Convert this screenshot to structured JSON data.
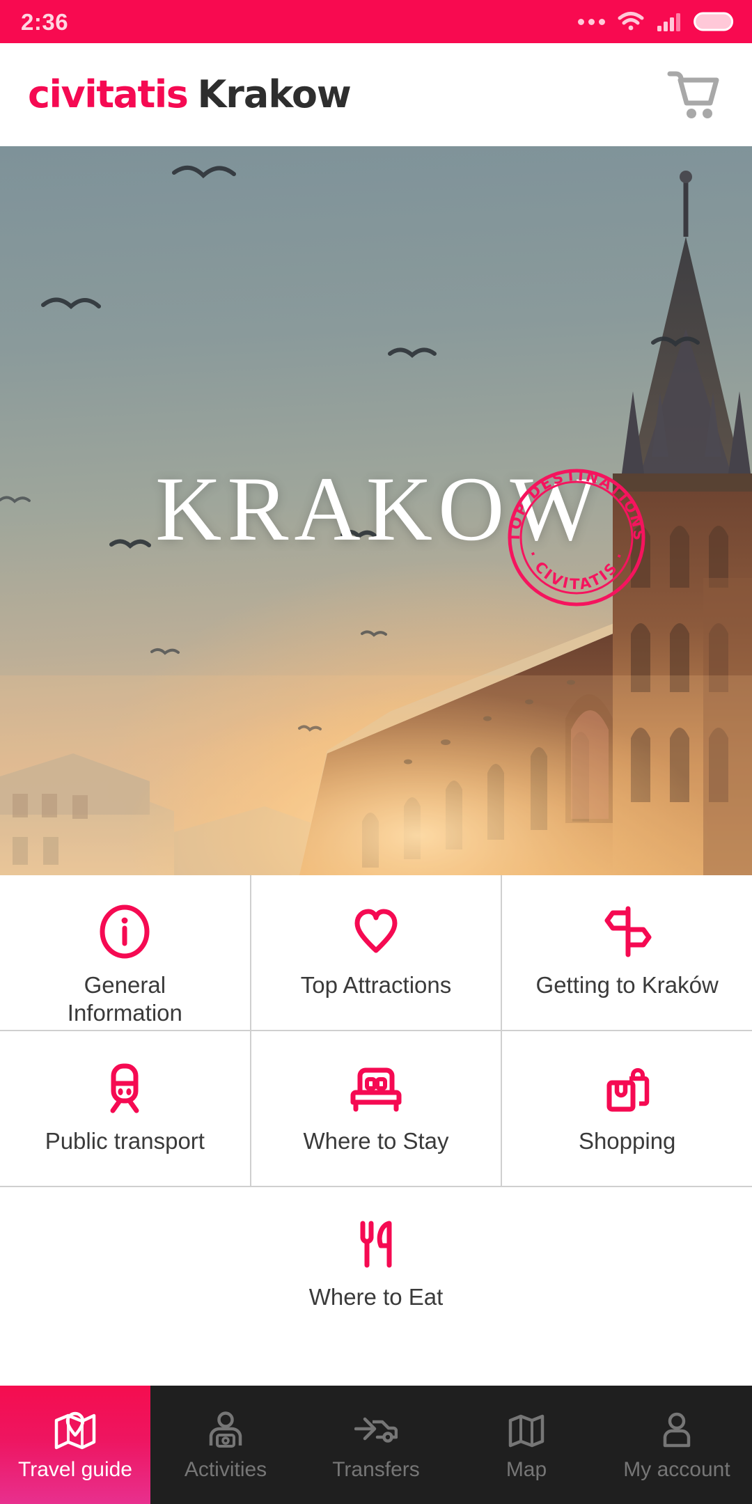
{
  "statusbar": {
    "time": "2:36",
    "icons": [
      "more-dots-icon",
      "wifi-icon",
      "cellular-signal-icon",
      "battery-icon"
    ]
  },
  "header": {
    "brand": "civitatis",
    "city": "Krakow",
    "cart_icon": "shopping-cart-icon"
  },
  "hero": {
    "title": "KRAKOW",
    "badge": {
      "top_text": "TOP DESTINATIONS",
      "bottom_text": "CIVITATIS",
      "color": "#F5145E"
    },
    "scene": "st-marys-basilica-krakow-at-sunset-with-birds"
  },
  "menu": {
    "rows": [
      [
        {
          "label": "General\nInformation",
          "label_line1": "General",
          "label_line2": "Information",
          "icon": "info-circle-icon"
        },
        {
          "label": "Top Attractions",
          "icon": "heart-icon"
        },
        {
          "label": "Getting to Kraków",
          "icon": "signpost-icon"
        }
      ],
      [
        {
          "label": "Public transport",
          "icon": "train-icon"
        },
        {
          "label": "Where to Stay",
          "icon": "bed-icon"
        },
        {
          "label": "Shopping",
          "icon": "shopping-bags-icon"
        }
      ],
      [
        {
          "label": "Where to Eat",
          "icon": "fork-knife-icon"
        }
      ]
    ]
  },
  "bottomnav": {
    "items": [
      {
        "label": "Travel guide",
        "icon": "folded-map-pin-icon",
        "active": true
      },
      {
        "label": "Activities",
        "icon": "person-camera-icon",
        "active": false
      },
      {
        "label": "Transfers",
        "icon": "car-arrow-icon",
        "active": false
      },
      {
        "label": "Map",
        "icon": "map-icon",
        "active": false
      },
      {
        "label": "My account",
        "icon": "user-icon",
        "active": false
      }
    ]
  },
  "colors": {
    "brand_pink": "#F50A52",
    "status_bar": "#F80A50",
    "nav_dark": "#1F1F1F",
    "nav_inactive_text": "#767676",
    "divider": "#CFCFCF"
  }
}
